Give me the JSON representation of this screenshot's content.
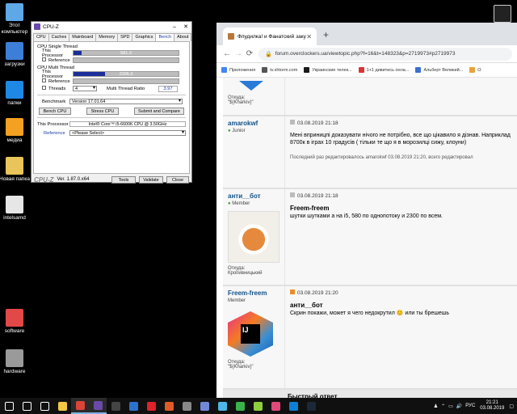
{
  "desktop": {
    "icons": [
      {
        "label": "Этот компьютер",
        "color": "#5fa8e8"
      },
      {
        "label": "загрузки",
        "color": "#3d7fd8"
      },
      {
        "label": "папки",
        "color": "#1e88e5"
      },
      {
        "label": "медиа",
        "color": "#f4a020"
      },
      {
        "label": "Новая папка",
        "color": "#e8c45a"
      },
      {
        "label": "intelsamd",
        "color": "#e6e6e6"
      },
      {
        "label": "software",
        "color": "#e34848"
      },
      {
        "label": "hardware",
        "color": "#9a9a9a"
      }
    ]
  },
  "cpuz": {
    "title": "CPU-Z",
    "tabs": [
      "CPU",
      "Caches",
      "Mainboard",
      "Memory",
      "SPD",
      "Graphics",
      "Bench",
      "About"
    ],
    "active_tab": "Bench",
    "single_thread": {
      "title": "CPU Single Thread",
      "this_label": "This Processor",
      "this_value": "581.3",
      "this_fill": 0.08,
      "ref_label": "Reference"
    },
    "multi_thread": {
      "title": "CPU Multi Thread",
      "this_label": "This Processor",
      "this_value": "2306.3",
      "this_fill": 0.3,
      "ref_label": "Reference",
      "threads_label": "Threads",
      "threads_value": "4",
      "ratio_label": "Multi Thread Ratio",
      "ratio_value": "3.97"
    },
    "benchmark_label": "Benchmark",
    "benchmark_version": "Version 17.01.64",
    "buttons": {
      "bench": "Bench CPU",
      "stress": "Stress CPU",
      "submit": "Submit and Compare"
    },
    "this_processor_label": "This Processor",
    "this_processor_value": "Intel® Core™ i5-6600K CPU @ 3.50GHz",
    "reference_label": "Reference",
    "reference_value": "<Please Select>",
    "footer": {
      "brand": "CPU-Z",
      "version": "Ver. 1.87.0.x64",
      "tools": "Tools",
      "validate": "Validate",
      "close": "Close"
    }
  },
  "browser": {
    "tab_title": "Флудилка! и Фанатский закуто",
    "url": "forum.overclockers.ua/viewtopic.php?f=16&t=148323&p=2719973#p2719973",
    "bookmarks": [
      {
        "label": "Приложения",
        "color": "#4285f4"
      },
      {
        "label": "tv.shtorm.com",
        "color": "#555555"
      },
      {
        "label": "Украинские телек...",
        "color": "#1a1a1a"
      },
      {
        "label": "1+1 дивитись онла...",
        "color": "#d33"
      },
      {
        "label": "Альберт Великий...",
        "color": "#3c6fd0"
      },
      {
        "label": "О",
        "color": "#e9a23b"
      }
    ],
    "top_partial": {
      "loc_label": "Откуда:",
      "loc_value": "\"${Kharkiv}\""
    },
    "posts": [
      {
        "author": "amarokwf",
        "rank": "Junior",
        "date": "03.08.2019 21:18",
        "text": "Мені вприницпі доказувати нічого не потрібно, все що цікавило я дізнав. Наприклад 8700к в іграх 10 градусів ( тільки те що я в морозилці сижу, клоуни)",
        "edited": "Последний раз редактировалось amarokwf 03.08.2019 21:20, всего редактировал"
      },
      {
        "author": "анти__бот",
        "rank": "Member",
        "date": "03.08.2019 21:18",
        "title": "Freem-freem",
        "text": "шутки шутками а на i5, 580 по однопотоку и 2300 по всем.",
        "loc_label": "Откуда:",
        "loc_value": "Кропивницький"
      },
      {
        "author": "Freem-freem",
        "rank": "Member",
        "date": "03.08.2019 21:20",
        "title": "анти__бот",
        "text": "Скрин покажи, может я чего недокрутил 😊 или ты брешешь",
        "loc_label": "Откуда:",
        "loc_value": "\"${Kharkiv}\""
      }
    ],
    "quick_reply": "Быстрый ответ"
  },
  "taskbar": {
    "icons": [
      {
        "name": "start",
        "color": "#ffffff"
      },
      {
        "name": "search",
        "color": "#ffffff"
      },
      {
        "name": "taskview",
        "color": "#ffffff"
      },
      {
        "name": "explorer",
        "color": "#f2c744"
      },
      {
        "name": "chrome",
        "color": "#db4437"
      },
      {
        "name": "cpu-z",
        "color": "#6a4aa8"
      },
      {
        "name": "calculator",
        "color": "#444444"
      },
      {
        "name": "mail",
        "color": "#2a73cc"
      },
      {
        "name": "opera",
        "color": "#e0222b"
      },
      {
        "name": "aimp",
        "color": "#e05a27"
      },
      {
        "name": "app",
        "color": "#888888"
      },
      {
        "name": "discord",
        "color": "#7289da"
      },
      {
        "name": "tool",
        "color": "#4db6e8"
      },
      {
        "name": "green",
        "color": "#3ab34a"
      },
      {
        "name": "green2",
        "color": "#8fce3c"
      },
      {
        "name": "pink",
        "color": "#e04a7a"
      },
      {
        "name": "teamviewer",
        "color": "#0e7fd6"
      },
      {
        "name": "steam",
        "color": "#1b2838"
      }
    ],
    "lang": "РУС",
    "time": "21:21",
    "date": "03.08.2019"
  }
}
